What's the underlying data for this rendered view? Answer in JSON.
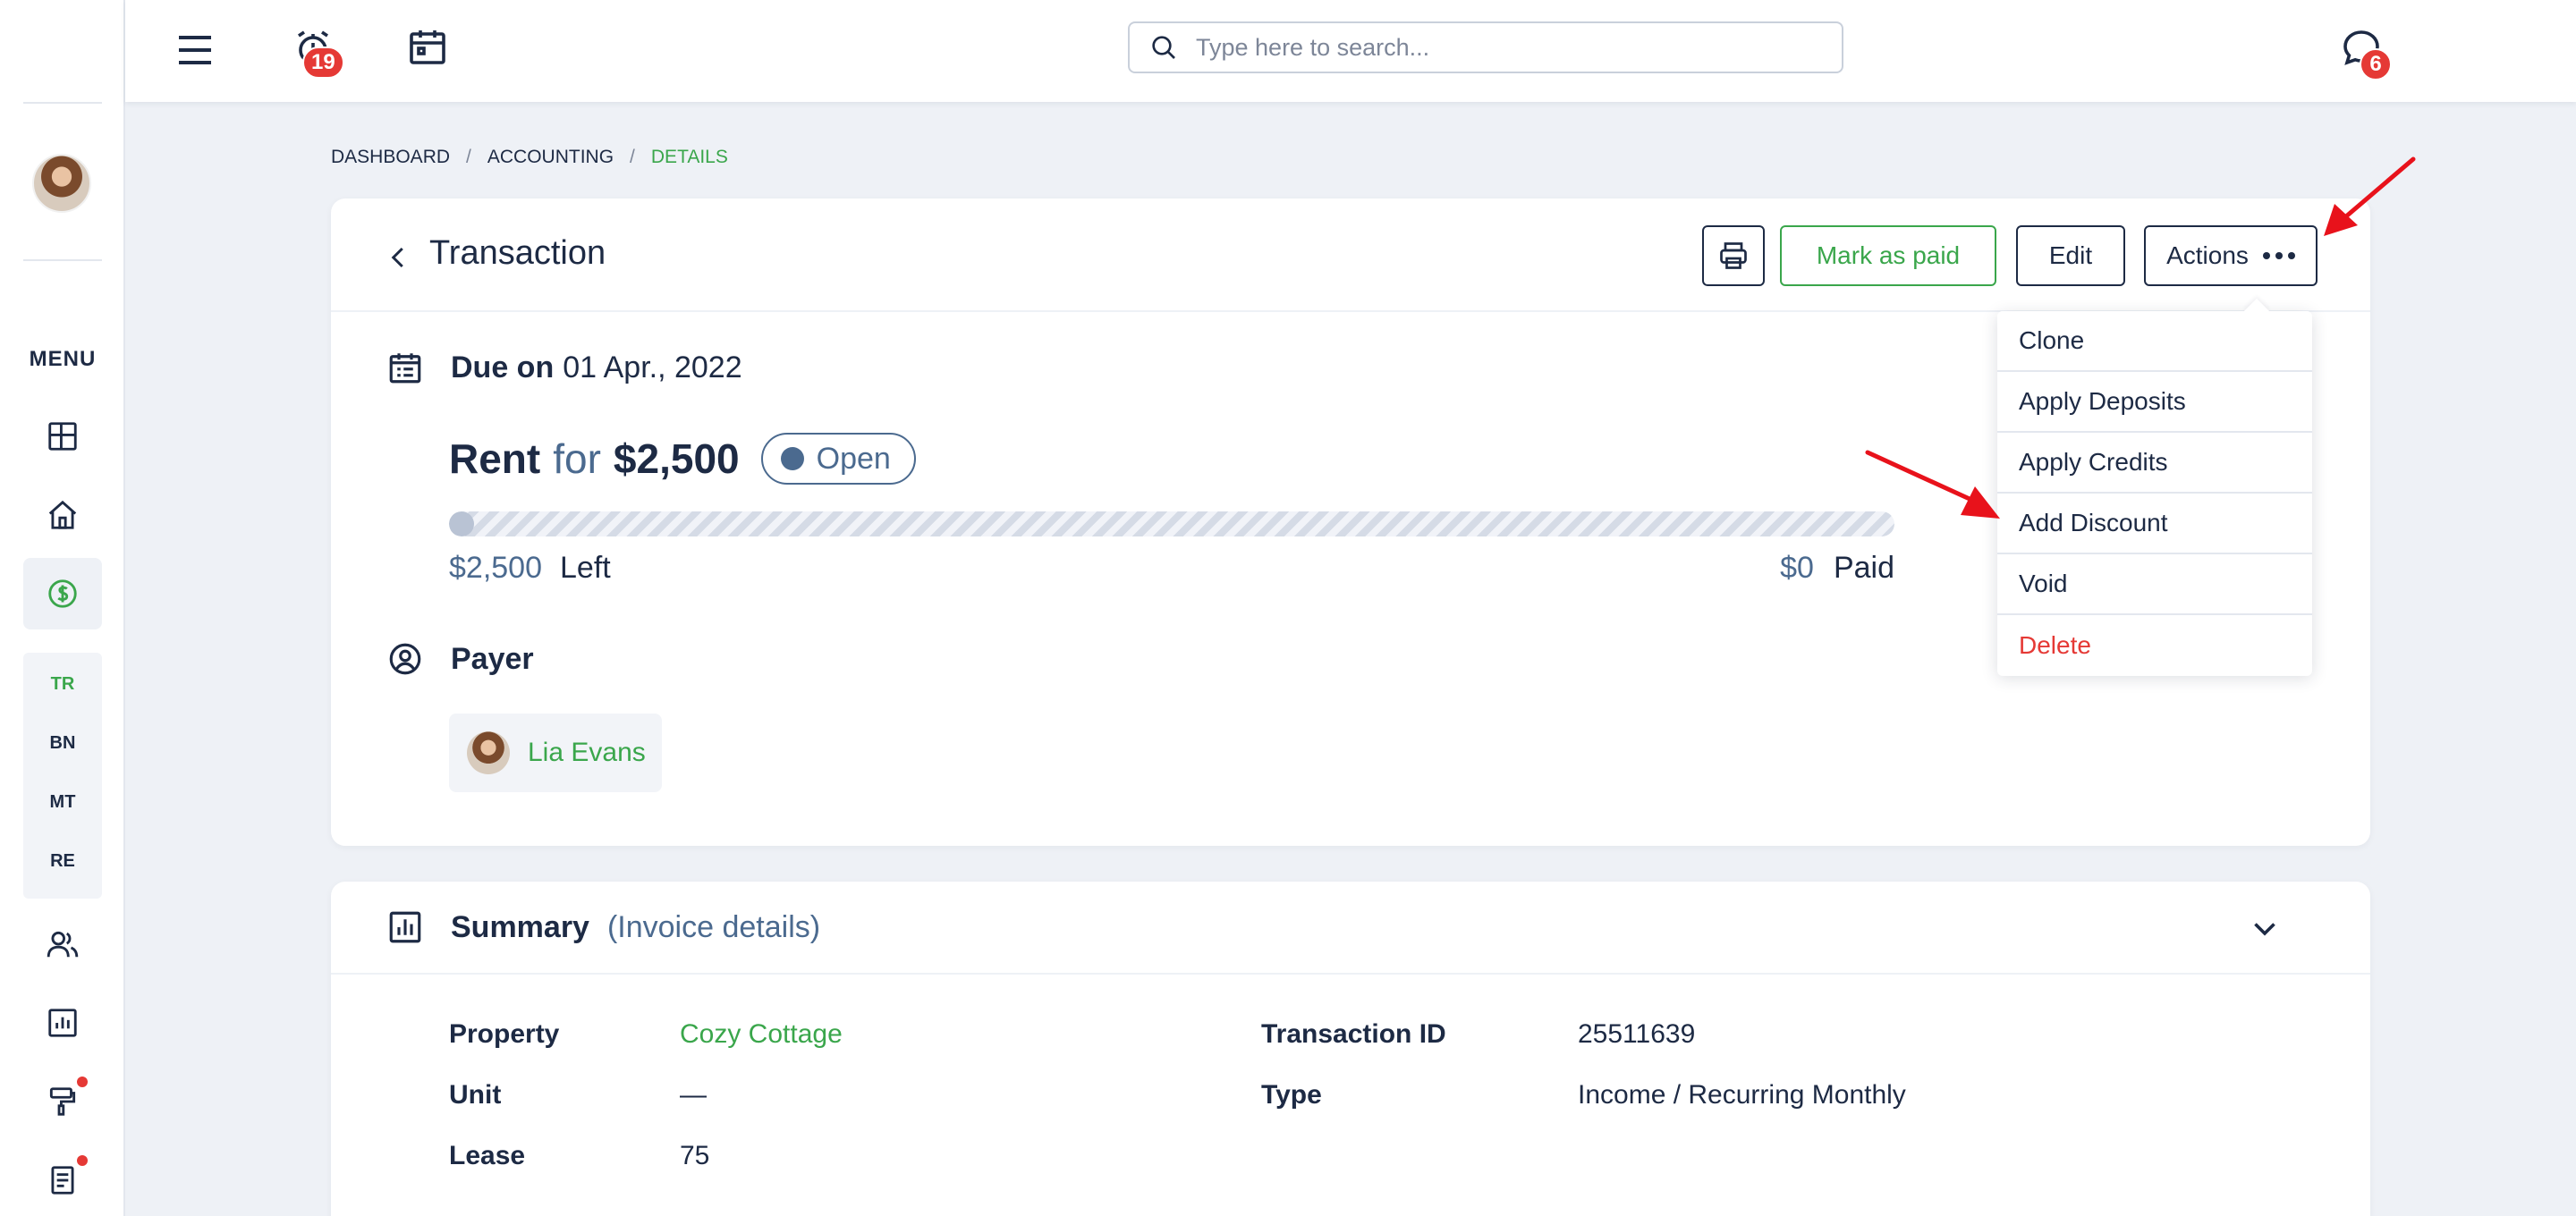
{
  "topbar": {
    "alerts_badge": "19",
    "messages_badge": "6",
    "search_placeholder": "Type here to search..."
  },
  "sidebar": {
    "menu_label": "MENU",
    "sub_items": [
      "TR",
      "BN",
      "MT",
      "RE"
    ]
  },
  "breadcrumb": {
    "items": [
      "DASHBOARD",
      "ACCOUNTING",
      "DETAILS"
    ],
    "separator": "/"
  },
  "transaction": {
    "title": "Transaction",
    "buttons": {
      "mark_paid": "Mark as paid",
      "edit": "Edit",
      "actions": "Actions"
    },
    "due_label": "Due on",
    "due_date": "01 Apr., 2022",
    "rent_name": "Rent",
    "rent_for": "for",
    "rent_amount": "$2,500",
    "status": "Open",
    "progress_paid_fraction": 0,
    "left_amount": "$2,500",
    "left_label": "Left",
    "paid_amount": "$0",
    "paid_label": "Paid",
    "payer_label": "Payer",
    "payer_name": "Lia Evans"
  },
  "actions_menu": {
    "items": [
      "Clone",
      "Apply Deposits",
      "Apply Credits",
      "Add Discount",
      "Void",
      "Delete"
    ]
  },
  "summary": {
    "title": "Summary",
    "subtitle": "(Invoice details)",
    "property_label": "Property",
    "property_value": "Cozy Cottage",
    "unit_label": "Unit",
    "unit_value": "—",
    "lease_label": "Lease",
    "lease_value": "75",
    "txid_label": "Transaction ID",
    "txid_value": "25511639",
    "type_label": "Type",
    "type_value": "Income / Recurring Monthly"
  },
  "colors": {
    "accent_green": "#3aa64b",
    "text_dark": "#1d2a44",
    "muted_blue": "#4b6a8f",
    "danger_red": "#e53935",
    "annotation_red": "#e8121b"
  }
}
